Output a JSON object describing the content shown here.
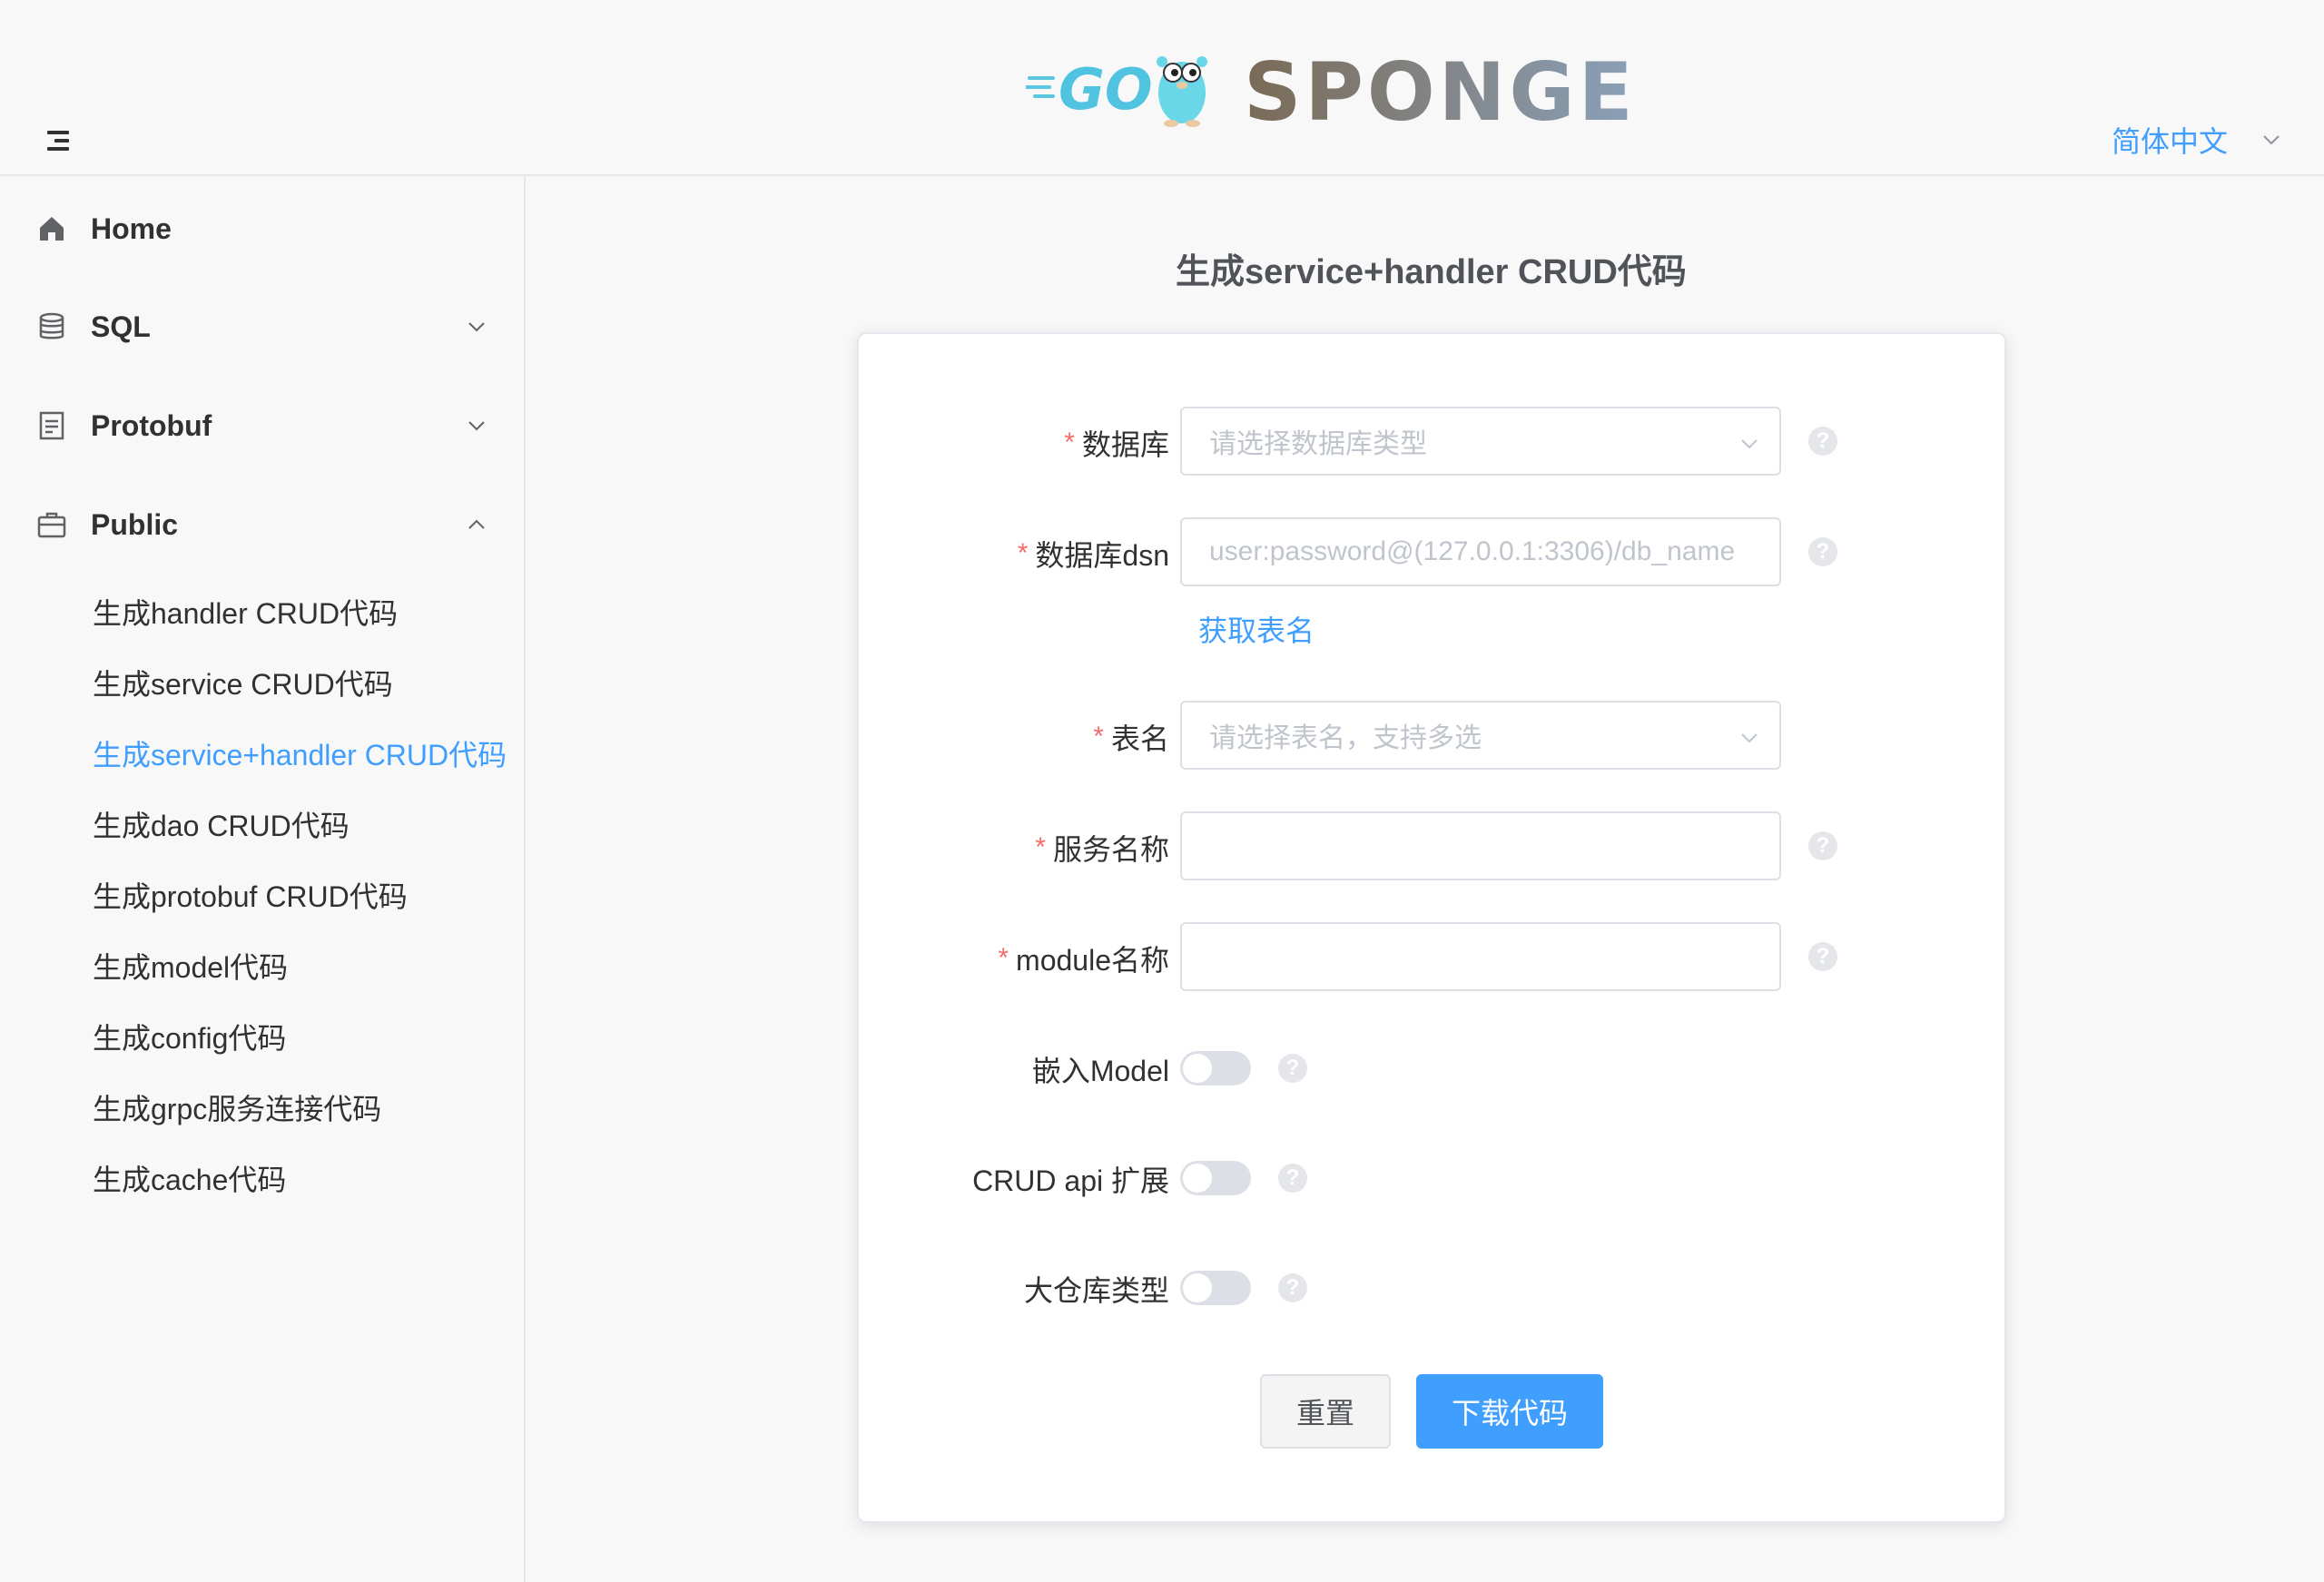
{
  "header": {
    "logo_text": "GO SPONGE",
    "language": "简体中文"
  },
  "sidebar": {
    "home": {
      "label": "Home",
      "icon": "home-icon"
    },
    "sql": {
      "label": "SQL",
      "icon": "database-icon"
    },
    "protobuf": {
      "label": "Protobuf",
      "icon": "document-icon"
    },
    "public": {
      "label": "Public",
      "icon": "briefcase-icon",
      "items": [
        "生成handler CRUD代码",
        "生成service CRUD代码",
        "生成service+handler CRUD代码",
        "生成dao CRUD代码",
        "生成protobuf CRUD代码",
        "生成model代码",
        "生成config代码",
        "生成grpc服务连接代码",
        "生成cache代码"
      ],
      "active_index": 2
    }
  },
  "main": {
    "title": "生成service+handler CRUD代码",
    "form": {
      "required_mark": "*",
      "db_type": {
        "label": "数据库",
        "placeholder": "请选择数据库类型"
      },
      "dsn": {
        "label": "数据库dsn",
        "placeholder": "user:password@(127.0.0.1:3306)/db_name",
        "value": ""
      },
      "fetch_tables_link": "获取表名",
      "tables": {
        "label": "表名",
        "placeholder": "请选择表名，支持多选"
      },
      "service_name": {
        "label": "服务名称",
        "value": ""
      },
      "module_name": {
        "label": "module名称",
        "value": ""
      },
      "embed_model": {
        "label": "嵌入Model",
        "on": false
      },
      "crud_ext": {
        "label": "CRUD api 扩展",
        "on": false
      },
      "mono_repo": {
        "label": "大仓库类型",
        "on": false
      },
      "help_mark": "?",
      "reset_label": "重置",
      "download_label": "下载代码"
    }
  },
  "colors": {
    "accent": "#409eff",
    "required": "#f56c6c",
    "background": "#f8f8f9"
  }
}
